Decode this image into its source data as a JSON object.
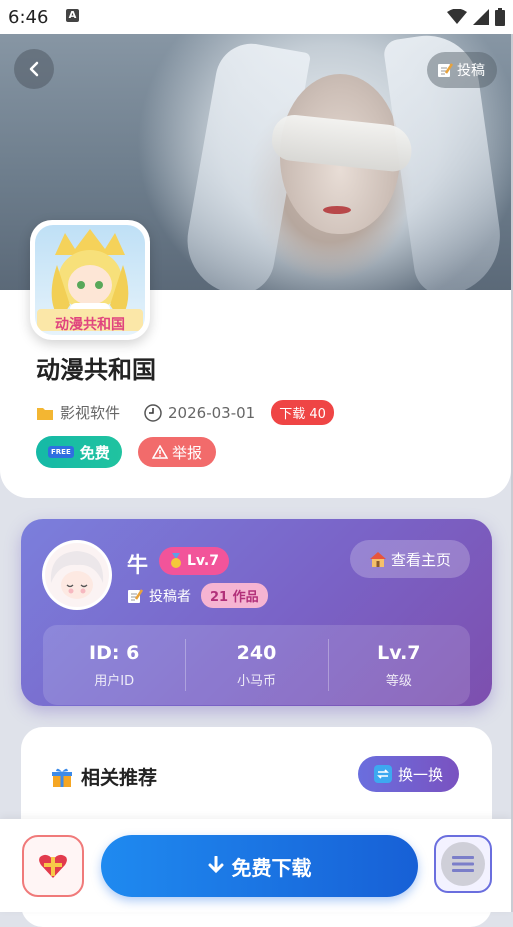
{
  "status_bar": {
    "time": "6:46",
    "notification_letter": "A"
  },
  "hero": {
    "submit_label": "投稿"
  },
  "app": {
    "icon_text": "动漫共和国",
    "name": "动漫共和国",
    "category": "影视软件",
    "date": "2026-03-01",
    "download_badge": "下载 40",
    "free_chip": "FREE",
    "free_label": "免费",
    "report_label": "举报"
  },
  "author": {
    "name": "牛",
    "level": "Lv.7",
    "role": "投稿者",
    "works": "21 作品",
    "home_label": "查看主页",
    "stats": [
      {
        "value": "ID: 6",
        "label": "用户ID"
      },
      {
        "value": "240",
        "label": "小马币"
      },
      {
        "value": "Lv.7",
        "label": "等级"
      }
    ]
  },
  "related": {
    "title": "相关推荐",
    "swap_label": "换一换"
  },
  "bottom": {
    "download_label": "免费下载"
  },
  "colors": {
    "accent_blue": "#1f8af0",
    "author_gradient_start": "#7b7fdc",
    "author_gradient_end": "#7d4fae",
    "badge_red": "#ef4545",
    "free_green": "#15b9a6",
    "level_pink": "#f2549a"
  }
}
